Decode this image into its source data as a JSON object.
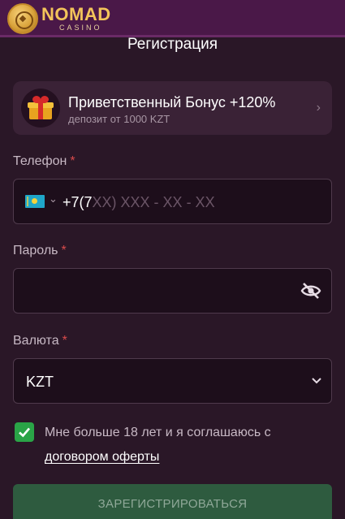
{
  "brand": {
    "name": "NOMAD",
    "sub": "CASINO"
  },
  "page": {
    "title": "Регистрация"
  },
  "bonus": {
    "title": "Приветственный Бонус +120%",
    "subtitle": "депозит от 1000 KZT",
    "icon": "gift-icon"
  },
  "phone": {
    "label": "Телефон",
    "required": "*",
    "country_flag": "kazakhstan-flag-icon",
    "value_prefix": "+7(7",
    "mask": "XX) XXX - XX - XX"
  },
  "password": {
    "label": "Пароль",
    "required": "*",
    "value": "",
    "toggle_icon": "eye-off-icon"
  },
  "currency": {
    "label": "Валюта",
    "required": "*",
    "selected": "KZT"
  },
  "agreement": {
    "checked": true,
    "text": "Мне больше 18 лет и я соглашаюсь с",
    "link": "договором оферты"
  },
  "submit": {
    "label": "ЗАРЕГИСТРИРОВАТЬСЯ"
  },
  "colors": {
    "background": "#2a1727",
    "topbar": "#4a1848",
    "accent_gold": "#f3c45a",
    "required": "#d94b4b",
    "checkbox": "#2aa447",
    "submit_bg": "#2e5b3f"
  }
}
